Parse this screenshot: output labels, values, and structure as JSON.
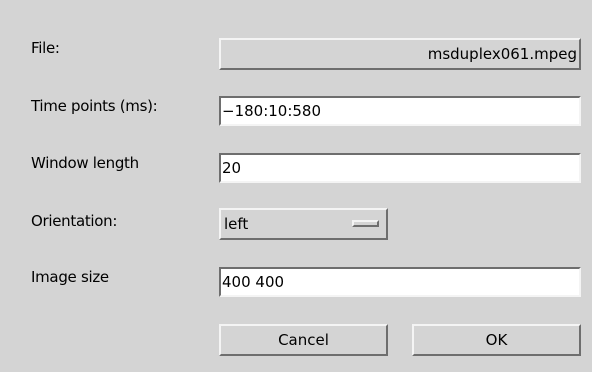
{
  "file": {
    "label": "File:",
    "button_value": "msduplex061.mpeg"
  },
  "time_points": {
    "label": "Time points (ms):",
    "value": "−180:10:580"
  },
  "window_length": {
    "label": "Window length",
    "value": "20"
  },
  "orientation": {
    "label": "Orientation:",
    "selected": "left"
  },
  "image_size": {
    "label": "Image size",
    "value": "400 400"
  },
  "buttons": {
    "cancel": "Cancel",
    "ok": "OK"
  },
  "colors": {
    "background": "#d4d4d4",
    "field_background": "#ffffff",
    "shadow": "#6e6e6e",
    "highlight": "#f4f4f4"
  }
}
